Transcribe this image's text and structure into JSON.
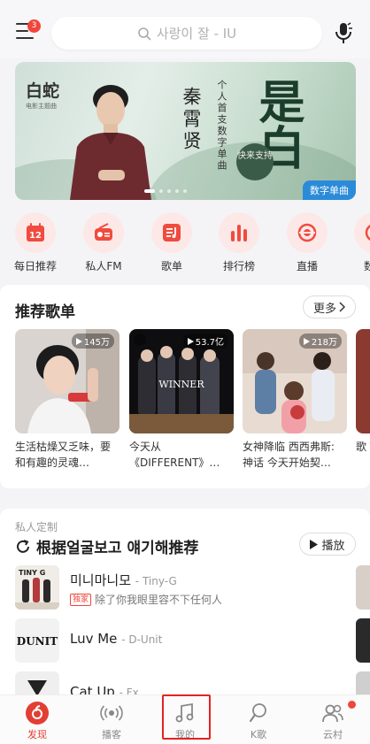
{
  "header": {
    "menu_badge": "3",
    "search_placeholder": "사랑이 잘 - IU"
  },
  "banner": {
    "logo": "白蛇",
    "logo_sub": "电影主题曲",
    "artist": "秦霄贤",
    "subtitle": "个人首支数字单曲",
    "calligraphy": "是白",
    "seal": "快来支持",
    "tag": "数字单曲"
  },
  "categories": [
    {
      "label": "每日推荐",
      "icon": "calendar-icon",
      "badge": "12"
    },
    {
      "label": "私人FM",
      "icon": "radio-icon"
    },
    {
      "label": "歌单",
      "icon": "playlist-icon"
    },
    {
      "label": "排行榜",
      "icon": "chart-bars-icon"
    },
    {
      "label": "直播",
      "icon": "live-icon"
    },
    {
      "label": "数字",
      "icon": "digital-album-icon"
    }
  ],
  "recommend": {
    "title": "推荐歌单",
    "more": "更多",
    "playlists": [
      {
        "count": "145万",
        "title": "生活枯燥又乏味，要和有趣的灵魂…"
      },
      {
        "count": "53.7亿",
        "title": "今天从《DIFFERENT》…",
        "cover_text": "WINNER"
      },
      {
        "count": "218万",
        "title": "女神降临 西西弗斯: 神话 今天开始契…"
      },
      {
        "count": "",
        "title": "歌 Tar"
      }
    ]
  },
  "radar": {
    "tag": "私人定制",
    "title": "根据얼굴보고 얘기해推荐",
    "play": "播放",
    "songs": [
      {
        "name": "미니마니모",
        "artist": "- Tiny-G",
        "exclusive": "独家",
        "info": "除了你我眼里容不下任何人",
        "cover_text": "TINY G"
      },
      {
        "name": "Luv Me",
        "artist": "- D-Unit",
        "cover_text": "DUNIT"
      },
      {
        "name": "Cat Up",
        "artist": "- Fx"
      }
    ]
  },
  "tabs": [
    {
      "label": "发现",
      "icon": "discover-icon",
      "active": true
    },
    {
      "label": "播客",
      "icon": "podcast-icon"
    },
    {
      "label": "我的",
      "icon": "music-note-icon"
    },
    {
      "label": "K歌",
      "icon": "karaoke-mic-icon"
    },
    {
      "label": "云村",
      "icon": "community-icon"
    }
  ],
  "colors": {
    "brand": "#e33e33",
    "badge": "#f0463c",
    "banner_tag": "#2b8bd9",
    "highlight": "#e52222"
  }
}
